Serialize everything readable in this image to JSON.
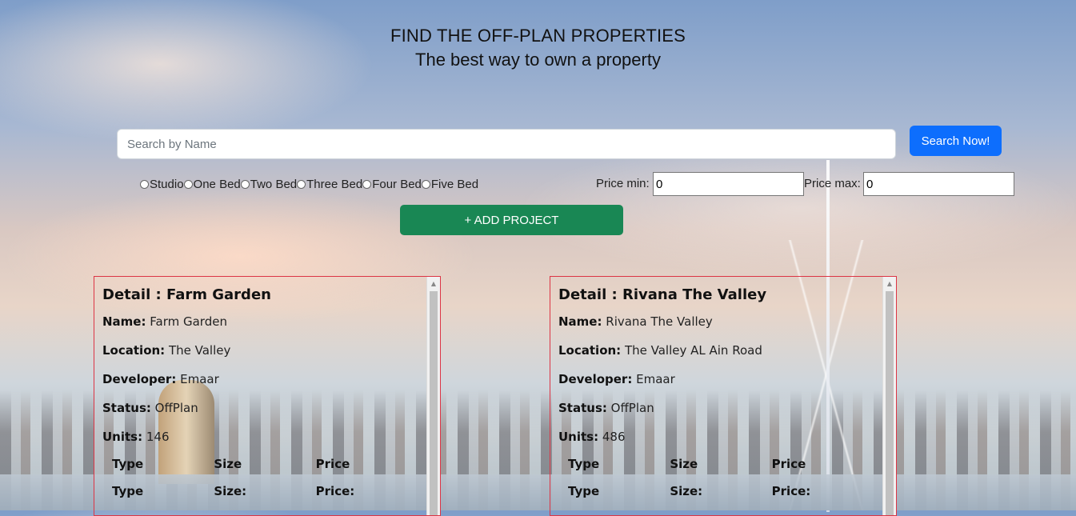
{
  "hero": {
    "title": "FIND THE OFF-PLAN PROPERTIES",
    "subtitle": "The best way to own a property"
  },
  "search": {
    "placeholder": "Search by Name",
    "button_label": "Search Now!"
  },
  "filters": {
    "bed_options": [
      "Studio",
      "One Bed",
      "Two Bed",
      "Three Bed",
      "Four Bed",
      "Five Bed"
    ],
    "price_min_label": "Price min:",
    "price_min_value": "0",
    "price_max_label": "Price max:",
    "price_max_value": "0"
  },
  "add_project_label": "+ ADD PROJECT",
  "cards": [
    {
      "heading": "Detail : Farm Garden",
      "name_label": "Name:",
      "name": "Farm Garden",
      "location_label": "Location:",
      "location": "The Valley",
      "developer_label": "Developer:",
      "developer": "Emaar",
      "status_label": "Status:",
      "status": "OffPlan",
      "units_label": "Units:",
      "units": "146",
      "columns_row1": [
        "Type",
        "Size",
        "Price"
      ],
      "columns_row2": [
        "Type",
        "Size:",
        "Price:"
      ]
    },
    {
      "heading": "Detail : Rivana The Valley",
      "name_label": "Name:",
      "name": "Rivana The Valley",
      "location_label": "Location:",
      "location": "The Valley AL Ain Road",
      "developer_label": "Developer:",
      "developer": "Emaar",
      "status_label": "Status:",
      "status": "OffPlan",
      "units_label": "Units:",
      "units": "486",
      "columns_row1": [
        "Type",
        "Size",
        "Price"
      ],
      "columns_row2": [
        "Type",
        "Size:",
        "Price:"
      ]
    }
  ]
}
